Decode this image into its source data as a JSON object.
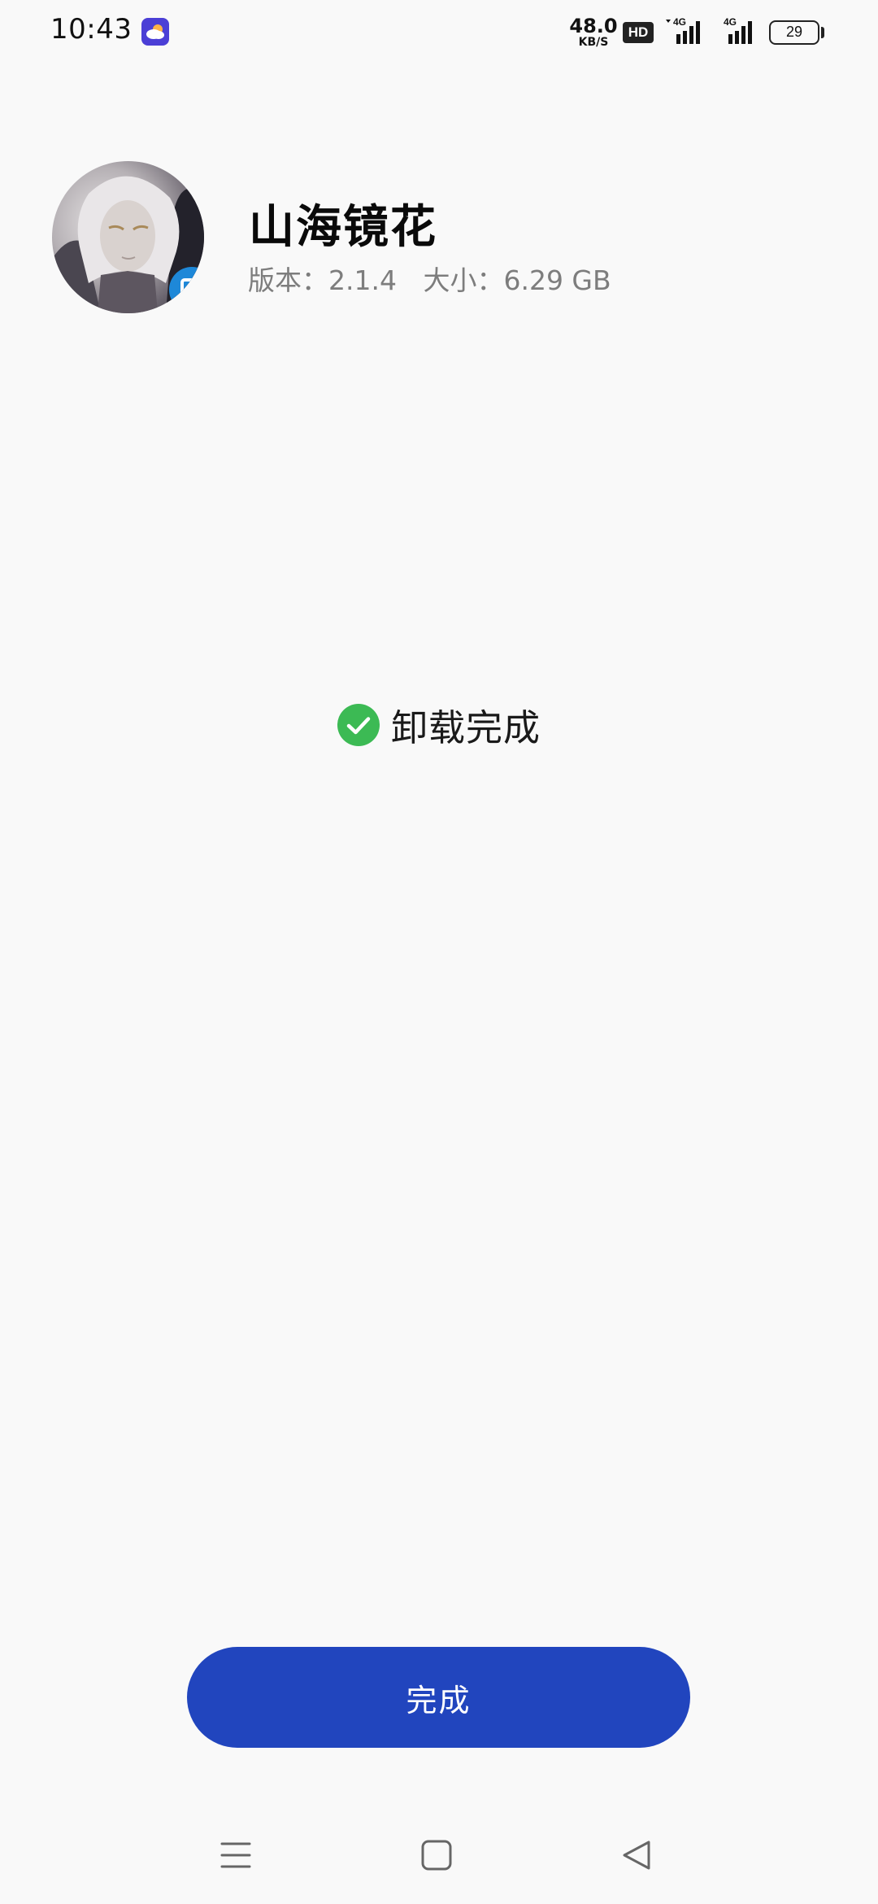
{
  "status_bar": {
    "time": "10:43",
    "net_speed_value": "48.0",
    "net_speed_unit": "KB/S",
    "hd_label": "HD",
    "network_1": "4G",
    "network_2": "4G",
    "battery_level": "29",
    "icons": [
      "weather-app-icon",
      "hd-voice-icon",
      "signal-4g-icon",
      "signal-4g-icon",
      "battery-icon"
    ]
  },
  "app": {
    "name": "山海镜花",
    "version_label": "版本：",
    "version": "2.1.4",
    "size_label": "大小：",
    "size": "6.29 GB"
  },
  "result": {
    "status_text": "卸载完成",
    "icon": "check-circle-icon",
    "icon_color": "#3cba54"
  },
  "actions": {
    "done_label": "完成",
    "done_color": "#2145be"
  },
  "nav_bar": {
    "buttons": [
      "menu-icon",
      "home-icon",
      "back-icon"
    ]
  }
}
